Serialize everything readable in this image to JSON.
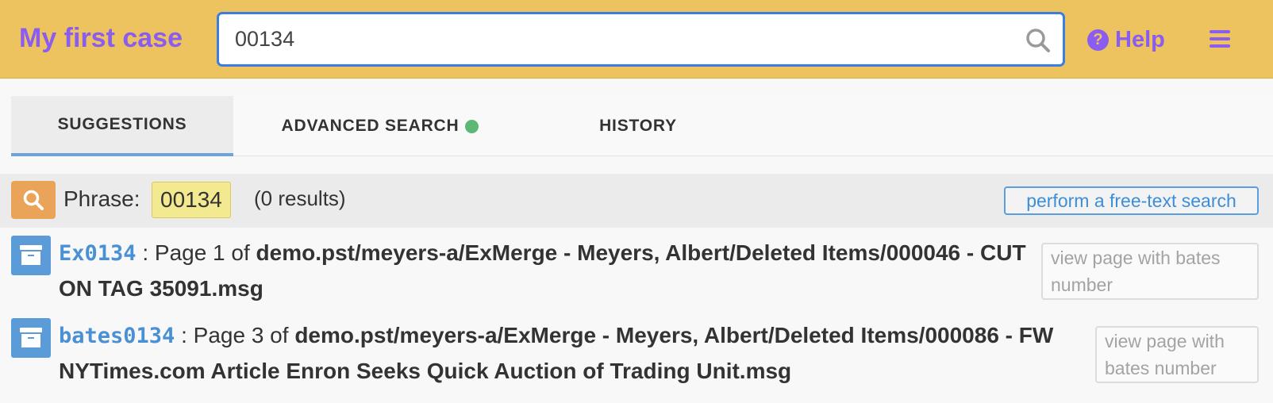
{
  "colors": {
    "header_bg": "#ecc35f",
    "accent_purple": "#8a5cf0",
    "link_blue": "#4a90d4",
    "phrase_chip": "#f3e990",
    "status_green": "#5cb874"
  },
  "header": {
    "case_title": "My first case",
    "search_value": "00134",
    "search_icon": "search-icon",
    "help_label": "Help",
    "help_icon": "question-circle-icon",
    "menu_icon": "hamburger-menu-icon"
  },
  "tabs": [
    {
      "label": "SUGGESTIONS",
      "active": true
    },
    {
      "label": "ADVANCED SEARCH",
      "active": false,
      "indicator": "green-dot"
    },
    {
      "label": "HISTORY",
      "active": false
    }
  ],
  "phrase": {
    "label": "Phrase:",
    "value": "00134",
    "results": "(0 results)",
    "free_text_button": "perform a free-text search"
  },
  "results": [
    {
      "bates": "Ex0134",
      "page_text": ": Page 1 of ",
      "path": "demo.pst/meyers-a/ExMerge - Meyers, Albert/Deleted Items/000046 - CUT ON TAG 35091.msg",
      "view_button": "view page with bates number"
    },
    {
      "bates": "bates0134",
      "page_text": ": Page 3 of ",
      "path": "demo.pst/meyers-a/ExMerge - Meyers, Albert/Deleted Items/000086 - FW NYTimes.com Article Enron Seeks Quick Auction of Trading Unit.msg",
      "view_button": "view page with bates number"
    }
  ]
}
